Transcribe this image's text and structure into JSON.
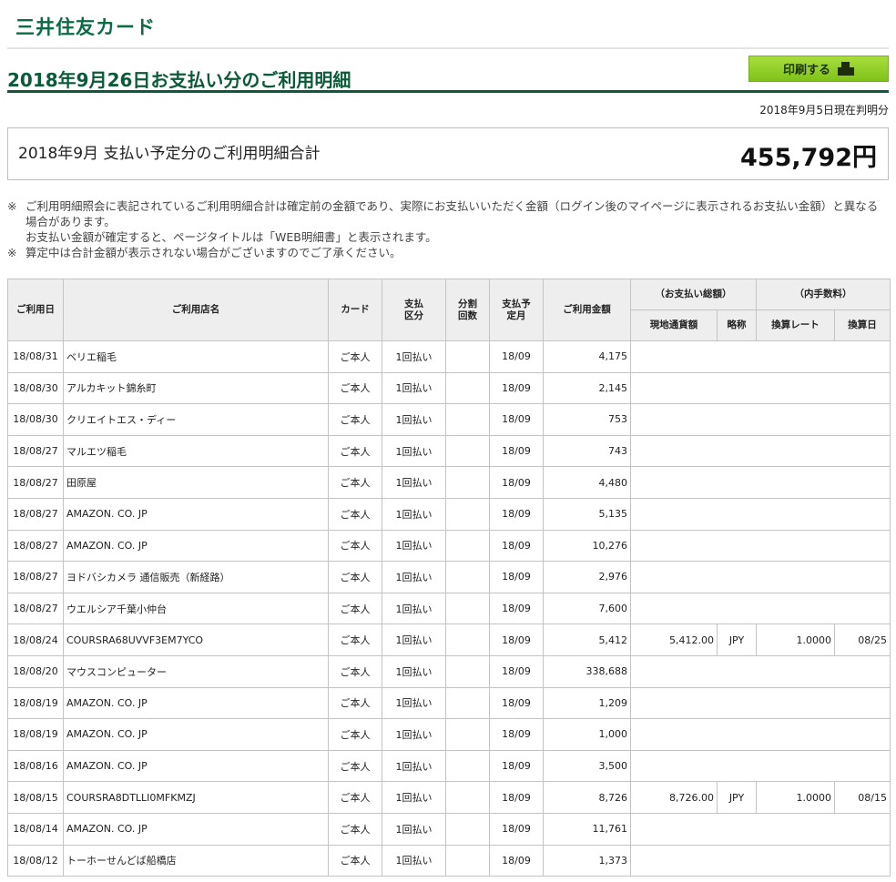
{
  "brand": {
    "logo_text": "三井住友カード"
  },
  "header": {
    "title": "2018年9月26日お支払い分のご利用明細",
    "print_label": "印刷する",
    "as_of": "2018年9月5日現在判明分"
  },
  "summary": {
    "label": "2018年9月 支払い予定分のご利用明細合計",
    "amount": "455,792円"
  },
  "notes": [
    {
      "mark": "※",
      "text": "ご利用明細照会に表記されているご利用明細合計は確定前の金額であり、実際にお支払いいただく金額（ログイン後のマイページに表示されるお支払い金額）と異なる場合があります。"
    },
    {
      "mark": "",
      "text": "お支払い金額が確定すると、ページタイトルは「WEB明細書」と表示されます。"
    },
    {
      "mark": "※",
      "text": "算定中は合計金額が表示されない場合がございますのでご了承ください。"
    }
  ],
  "table": {
    "headers": {
      "date": "ご利用日",
      "shop": "ご利用店名",
      "card": "カード",
      "pay_type": "支払区分",
      "installments": "分割回数",
      "pay_month": "支払予定月",
      "amount": "ご利用金額",
      "foreign_group": "（お支払い総額）",
      "local_amount": "現地通貨額",
      "currency": "略称",
      "fee_group": "（内手数料）",
      "rate": "換算レート",
      "conv_date": "換算日"
    },
    "rows": [
      {
        "date": "18/08/31",
        "shop": "ベリエ稲毛",
        "card": "ご本人",
        "pay_type": "1回払い",
        "installments": "",
        "pay_month": "18/09",
        "amount": "4,175",
        "local_amount": "",
        "currency": "",
        "rate": "",
        "conv_date": ""
      },
      {
        "date": "18/08/30",
        "shop": "アルカキット錦糸町",
        "card": "ご本人",
        "pay_type": "1回払い",
        "installments": "",
        "pay_month": "18/09",
        "amount": "2,145",
        "local_amount": "",
        "currency": "",
        "rate": "",
        "conv_date": ""
      },
      {
        "date": "18/08/30",
        "shop": "クリエイトエス・ディー",
        "card": "ご本人",
        "pay_type": "1回払い",
        "installments": "",
        "pay_month": "18/09",
        "amount": "753",
        "local_amount": "",
        "currency": "",
        "rate": "",
        "conv_date": ""
      },
      {
        "date": "18/08/27",
        "shop": "マルエツ稲毛",
        "card": "ご本人",
        "pay_type": "1回払い",
        "installments": "",
        "pay_month": "18/09",
        "amount": "743",
        "local_amount": "",
        "currency": "",
        "rate": "",
        "conv_date": ""
      },
      {
        "date": "18/08/27",
        "shop": "田原屋",
        "card": "ご本人",
        "pay_type": "1回払い",
        "installments": "",
        "pay_month": "18/09",
        "amount": "4,480",
        "local_amount": "",
        "currency": "",
        "rate": "",
        "conv_date": ""
      },
      {
        "date": "18/08/27",
        "shop": "AMAZON. CO. JP",
        "card": "ご本人",
        "pay_type": "1回払い",
        "installments": "",
        "pay_month": "18/09",
        "amount": "5,135",
        "local_amount": "",
        "currency": "",
        "rate": "",
        "conv_date": ""
      },
      {
        "date": "18/08/27",
        "shop": "AMAZON. CO. JP",
        "card": "ご本人",
        "pay_type": "1回払い",
        "installments": "",
        "pay_month": "18/09",
        "amount": "10,276",
        "local_amount": "",
        "currency": "",
        "rate": "",
        "conv_date": ""
      },
      {
        "date": "18/08/27",
        "shop": "ヨドバシカメラ 通信販売（新経路）",
        "card": "ご本人",
        "pay_type": "1回払い",
        "installments": "",
        "pay_month": "18/09",
        "amount": "2,976",
        "local_amount": "",
        "currency": "",
        "rate": "",
        "conv_date": ""
      },
      {
        "date": "18/08/27",
        "shop": "ウエルシア千葉小仲台",
        "card": "ご本人",
        "pay_type": "1回払い",
        "installments": "",
        "pay_month": "18/09",
        "amount": "7,600",
        "local_amount": "",
        "currency": "",
        "rate": "",
        "conv_date": ""
      },
      {
        "date": "18/08/24",
        "shop": "COURSRA68UVVF3EM7YCO",
        "card": "ご本人",
        "pay_type": "1回払い",
        "installments": "",
        "pay_month": "18/09",
        "amount": "5,412",
        "local_amount": "5,412.00",
        "currency": "JPY",
        "rate": "1.0000",
        "conv_date": "08/25"
      },
      {
        "date": "18/08/20",
        "shop": "マウスコンピューター",
        "card": "ご本人",
        "pay_type": "1回払い",
        "installments": "",
        "pay_month": "18/09",
        "amount": "338,688",
        "local_amount": "",
        "currency": "",
        "rate": "",
        "conv_date": ""
      },
      {
        "date": "18/08/19",
        "shop": "AMAZON. CO. JP",
        "card": "ご本人",
        "pay_type": "1回払い",
        "installments": "",
        "pay_month": "18/09",
        "amount": "1,209",
        "local_amount": "",
        "currency": "",
        "rate": "",
        "conv_date": ""
      },
      {
        "date": "18/08/19",
        "shop": "AMAZON. CO. JP",
        "card": "ご本人",
        "pay_type": "1回払い",
        "installments": "",
        "pay_month": "18/09",
        "amount": "1,000",
        "local_amount": "",
        "currency": "",
        "rate": "",
        "conv_date": ""
      },
      {
        "date": "18/08/16",
        "shop": "AMAZON. CO. JP",
        "card": "ご本人",
        "pay_type": "1回払い",
        "installments": "",
        "pay_month": "18/09",
        "amount": "3,500",
        "local_amount": "",
        "currency": "",
        "rate": "",
        "conv_date": ""
      },
      {
        "date": "18/08/15",
        "shop": "COURSRA8DTLLI0MFKMZJ",
        "card": "ご本人",
        "pay_type": "1回払い",
        "installments": "",
        "pay_month": "18/09",
        "amount": "8,726",
        "local_amount": "8,726.00",
        "currency": "JPY",
        "rate": "1.0000",
        "conv_date": "08/15"
      },
      {
        "date": "18/08/14",
        "shop": "AMAZON. CO. JP",
        "card": "ご本人",
        "pay_type": "1回払い",
        "installments": "",
        "pay_month": "18/09",
        "amount": "11,761",
        "local_amount": "",
        "currency": "",
        "rate": "",
        "conv_date": ""
      },
      {
        "date": "18/08/12",
        "shop": "トーホーせんどば船橋店",
        "card": "ご本人",
        "pay_type": "1回払い",
        "installments": "",
        "pay_month": "18/09",
        "amount": "1,373",
        "local_amount": "",
        "currency": "",
        "rate": "",
        "conv_date": ""
      }
    ]
  },
  "colors": {
    "brand_green": "#0b5a39",
    "button_green": "#8fd12a",
    "header_bg": "#eeeeee",
    "border": "#c4c4c4"
  },
  "icons": {
    "print": "printer-icon"
  }
}
